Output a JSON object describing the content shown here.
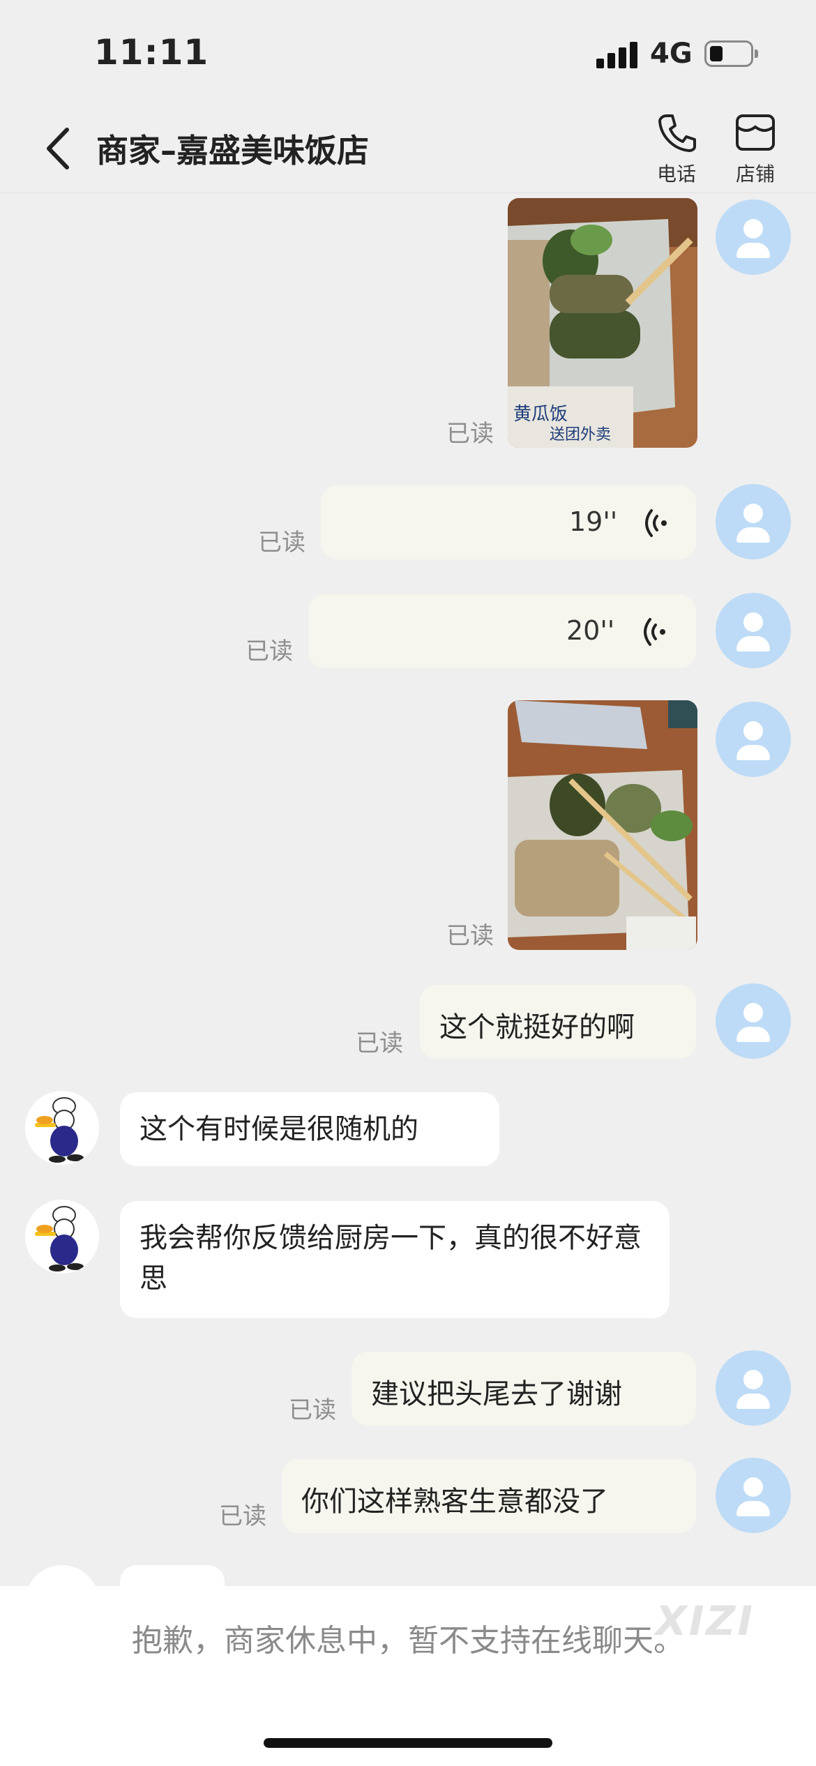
{
  "status_bar": {
    "time": "11:11",
    "network": "4G"
  },
  "header": {
    "title": "商家–嘉盛美味饭店",
    "phone_label": "电话",
    "shop_label": "店铺"
  },
  "messages": {
    "read_label": "已读",
    "voice1_duration": "19''",
    "voice2_duration": "20''",
    "text1": "这个就挺好的啊",
    "shop_reply1": "这个有时候是很随机的",
    "shop_reply2": "我会帮你反馈给厨房一下，真的很不好意思",
    "text2": "建议把头尾去了谢谢",
    "text3": "你们这样熟客生意都没了",
    "photo1_caption": "黄瓜饭",
    "photo1_caption2": "送团外卖"
  },
  "notice": {
    "text": "抱歉，商家休息中，暂不支持在线聊天。"
  },
  "watermark": "XIZI",
  "colors": {
    "background": "#efefef",
    "user_avatar": "#bddbf6",
    "bubble_right": "#f6f6ee",
    "bubble_left": "#ffffff"
  }
}
